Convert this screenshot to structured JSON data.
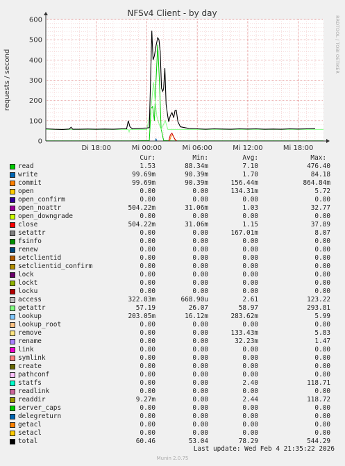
{
  "chart_data": {
    "type": "line",
    "title": "NFSv4 Client - by day",
    "ylabel": "requests / second",
    "watermark": "RRDTOOL / TOBI OETIKER",
    "ylim": [
      0,
      600
    ],
    "yticks": [
      0,
      100,
      200,
      300,
      400,
      500,
      600
    ],
    "xlim": [
      0,
      33
    ],
    "xticks": [
      {
        "x": 6,
        "label": "Di 18:00"
      },
      {
        "x": 12,
        "label": "Mi 00:00"
      },
      {
        "x": 18,
        "label": "Mi 06:00"
      },
      {
        "x": 24,
        "label": "Mi 12:00"
      },
      {
        "x": 30,
        "label": "Mi 18:00"
      }
    ],
    "x_unit": "hours since Di 12:00",
    "grid": true,
    "series": [
      {
        "name": "total",
        "color": "#000000",
        "points": [
          [
            0,
            60
          ],
          [
            1,
            58
          ],
          [
            2,
            57
          ],
          [
            2.8,
            59
          ],
          [
            3,
            68
          ],
          [
            3.2,
            58
          ],
          [
            4,
            58
          ],
          [
            5,
            59
          ],
          [
            6,
            58
          ],
          [
            7,
            59
          ],
          [
            8,
            58
          ],
          [
            9,
            60
          ],
          [
            9.6,
            60
          ],
          [
            9.8,
            100
          ],
          [
            10,
            70
          ],
          [
            10.3,
            60
          ],
          [
            11,
            62
          ],
          [
            11.5,
            63
          ],
          [
            12,
            64
          ],
          [
            12.3,
            66
          ],
          [
            12.45,
            300
          ],
          [
            12.6,
            544
          ],
          [
            12.75,
            400
          ],
          [
            12.9,
            420
          ],
          [
            13.1,
            470
          ],
          [
            13.3,
            510
          ],
          [
            13.45,
            500
          ],
          [
            13.6,
            440
          ],
          [
            13.75,
            260
          ],
          [
            13.9,
            245
          ],
          [
            14,
            260
          ],
          [
            14.15,
            360
          ],
          [
            14.3,
            180
          ],
          [
            14.5,
            120
          ],
          [
            14.6,
            95
          ],
          [
            14.8,
            125
          ],
          [
            15,
            140
          ],
          [
            15.2,
            115
          ],
          [
            15.35,
            150
          ],
          [
            15.5,
            152
          ],
          [
            15.7,
            95
          ],
          [
            16,
            70
          ],
          [
            17,
            62
          ],
          [
            18,
            60
          ],
          [
            19,
            58
          ],
          [
            20,
            60
          ],
          [
            21,
            59
          ],
          [
            22,
            58
          ],
          [
            23,
            60
          ],
          [
            24,
            59
          ],
          [
            25,
            60
          ],
          [
            26,
            58
          ],
          [
            27,
            59
          ],
          [
            28,
            58
          ],
          [
            29,
            60
          ],
          [
            30,
            59
          ],
          [
            31,
            60
          ],
          [
            32,
            61
          ]
        ]
      },
      {
        "name": "read",
        "color": "#00cc00",
        "points": [
          [
            0,
            1
          ],
          [
            10,
            1
          ],
          [
            12.3,
            2
          ],
          [
            12.5,
            160
          ],
          [
            12.7,
            170
          ],
          [
            12.9,
            100
          ],
          [
            13.1,
            300
          ],
          [
            13.3,
            476
          ],
          [
            13.5,
            300
          ],
          [
            13.7,
            60
          ],
          [
            14,
            2
          ],
          [
            15,
            1
          ],
          [
            33,
            1
          ]
        ]
      },
      {
        "name": "getattr",
        "color": "#88ff88",
        "points": [
          [
            0,
            57
          ],
          [
            3,
            57
          ],
          [
            9.8,
            57
          ],
          [
            9.9,
            45
          ],
          [
            10,
            57
          ],
          [
            12,
            57
          ],
          [
            12.5,
            160
          ],
          [
            12.8,
            290
          ],
          [
            13.0,
            190
          ],
          [
            13.2,
            120
          ],
          [
            13.5,
            80
          ],
          [
            13.7,
            57
          ],
          [
            14.2,
            100
          ],
          [
            14.5,
            57
          ],
          [
            33,
            57
          ]
        ]
      },
      {
        "name": "write",
        "color": "#0066b3",
        "points": [
          [
            0,
            0
          ],
          [
            13,
            0
          ],
          [
            13.1,
            10
          ],
          [
            13.2,
            0
          ],
          [
            33,
            0
          ]
        ]
      },
      {
        "name": "commit",
        "color": "#ff8000",
        "points": [
          [
            0,
            0
          ],
          [
            14.7,
            0
          ],
          [
            14.9,
            25
          ],
          [
            15.1,
            30
          ],
          [
            15.3,
            10
          ],
          [
            15.5,
            0
          ],
          [
            33,
            0
          ]
        ]
      },
      {
        "name": "close",
        "color": "#cc0000",
        "points": [
          [
            0,
            0
          ],
          [
            14.6,
            0
          ],
          [
            14.8,
            30
          ],
          [
            15.0,
            38
          ],
          [
            15.2,
            20
          ],
          [
            15.4,
            5
          ],
          [
            15.6,
            0
          ],
          [
            33,
            0
          ]
        ]
      }
    ]
  },
  "legend": {
    "headers": {
      "cur": "Cur:",
      "min": "Min:",
      "avg": "Avg:",
      "max": "Max:"
    },
    "rows": [
      {
        "name": "read",
        "color": "#00cc00",
        "cur": "1.53",
        "min": "88.34m",
        "avg": "7.10",
        "max": "476.40"
      },
      {
        "name": "write",
        "color": "#0066b3",
        "cur": "99.69m",
        "min": "90.39m",
        "avg": "1.70",
        "max": "84.18"
      },
      {
        "name": "commit",
        "color": "#ff8000",
        "cur": "99.69m",
        "min": "90.39m",
        "avg": "156.44m",
        "max": "864.84m"
      },
      {
        "name": "open",
        "color": "#ffcc00",
        "cur": "0.00",
        "min": "0.00",
        "avg": "134.31m",
        "max": "5.72"
      },
      {
        "name": "open_confirm",
        "color": "#330099",
        "cur": "0.00",
        "min": "0.00",
        "avg": "0.00",
        "max": "0.00"
      },
      {
        "name": "open_noattr",
        "color": "#990099",
        "cur": "504.22m",
        "min": "31.06m",
        "avg": "1.03",
        "max": "32.77"
      },
      {
        "name": "open_downgrade",
        "color": "#ccff00",
        "cur": "0.00",
        "min": "0.00",
        "avg": "0.00",
        "max": "0.00"
      },
      {
        "name": "close",
        "color": "#ff0000",
        "cur": "504.22m",
        "min": "31.06m",
        "avg": "1.15",
        "max": "37.89"
      },
      {
        "name": "setattr",
        "color": "#808080",
        "cur": "0.00",
        "min": "0.00",
        "avg": "167.01m",
        "max": "8.07"
      },
      {
        "name": "fsinfo",
        "color": "#008f00",
        "cur": "0.00",
        "min": "0.00",
        "avg": "0.00",
        "max": "0.00"
      },
      {
        "name": "renew",
        "color": "#00487d",
        "cur": "0.00",
        "min": "0.00",
        "avg": "0.00",
        "max": "0.00"
      },
      {
        "name": "setclientid",
        "color": "#b35a00",
        "cur": "0.00",
        "min": "0.00",
        "avg": "0.00",
        "max": "0.00"
      },
      {
        "name": "setclientid_confirm",
        "color": "#b38f00",
        "cur": "0.00",
        "min": "0.00",
        "avg": "0.00",
        "max": "0.00"
      },
      {
        "name": "lock",
        "color": "#6b006b",
        "cur": "0.00",
        "min": "0.00",
        "avg": "0.00",
        "max": "0.00"
      },
      {
        "name": "lockt",
        "color": "#8fb300",
        "cur": "0.00",
        "min": "0.00",
        "avg": "0.00",
        "max": "0.00"
      },
      {
        "name": "locku",
        "color": "#b30000",
        "cur": "0.00",
        "min": "0.00",
        "avg": "0.00",
        "max": "0.00"
      },
      {
        "name": "access",
        "color": "#bebebe",
        "cur": "322.03m",
        "min": "668.90u",
        "avg": "2.61",
        "max": "123.22"
      },
      {
        "name": "getattr",
        "color": "#80ff80",
        "cur": "57.19",
        "min": "26.07",
        "avg": "58.97",
        "max": "293.81"
      },
      {
        "name": "lookup",
        "color": "#80c9ff",
        "cur": "203.05m",
        "min": "16.12m",
        "avg": "283.62m",
        "max": "5.99"
      },
      {
        "name": "lookup_root",
        "color": "#ffc080",
        "cur": "0.00",
        "min": "0.00",
        "avg": "0.00",
        "max": "0.00"
      },
      {
        "name": "remove",
        "color": "#ffe680",
        "cur": "0.00",
        "min": "0.00",
        "avg": "133.43m",
        "max": "5.83"
      },
      {
        "name": "rename",
        "color": "#aa80ff",
        "cur": "0.00",
        "min": "0.00",
        "avg": "32.23m",
        "max": "1.47"
      },
      {
        "name": "link",
        "color": "#ee00cc",
        "cur": "0.00",
        "min": "0.00",
        "avg": "0.00",
        "max": "0.00"
      },
      {
        "name": "symlink",
        "color": "#ff8080",
        "cur": "0.00",
        "min": "0.00",
        "avg": "0.00",
        "max": "0.00"
      },
      {
        "name": "create",
        "color": "#666600",
        "cur": "0.00",
        "min": "0.00",
        "avg": "0.00",
        "max": "0.00"
      },
      {
        "name": "pathconf",
        "color": "#ffbfff",
        "cur": "0.00",
        "min": "0.00",
        "avg": "0.00",
        "max": "0.00"
      },
      {
        "name": "statfs",
        "color": "#00ffcc",
        "cur": "0.00",
        "min": "0.00",
        "avg": "2.40",
        "max": "118.71"
      },
      {
        "name": "readlink",
        "color": "#cc6699",
        "cur": "0.00",
        "min": "0.00",
        "avg": "0.00",
        "max": "0.00"
      },
      {
        "name": "readdir",
        "color": "#999900",
        "cur": "9.27m",
        "min": "0.00",
        "avg": "2.44",
        "max": "118.72"
      },
      {
        "name": "server_caps",
        "color": "#00cc00",
        "cur": "0.00",
        "min": "0.00",
        "avg": "0.00",
        "max": "0.00"
      },
      {
        "name": "delegreturn",
        "color": "#0066b3",
        "cur": "0.00",
        "min": "0.00",
        "avg": "0.00",
        "max": "0.00"
      },
      {
        "name": "getacl",
        "color": "#ff8000",
        "cur": "0.00",
        "min": "0.00",
        "avg": "0.00",
        "max": "0.00"
      },
      {
        "name": "setacl",
        "color": "#ffcc00",
        "cur": "0.00",
        "min": "0.00",
        "avg": "0.00",
        "max": "0.00"
      },
      {
        "name": "total",
        "color": "#000000",
        "cur": "60.46",
        "min": "53.04",
        "avg": "78.29",
        "max": "544.29"
      }
    ]
  },
  "footer": {
    "last_update": "Last update: Wed Feb  4 21:35:22 2026",
    "version": "Munin 2.0.75"
  }
}
